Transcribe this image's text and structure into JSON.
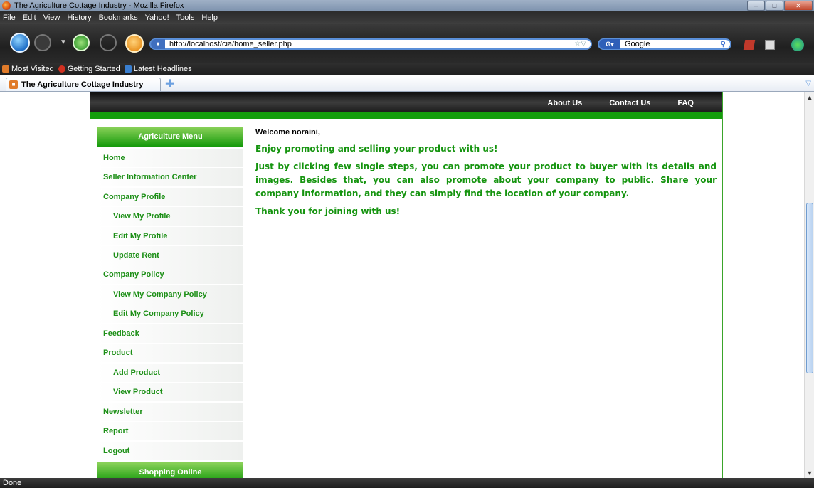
{
  "window": {
    "title": "The Agriculture Cottage Industry - Mozilla Firefox",
    "controls": [
      "minimize",
      "maximize",
      "close"
    ]
  },
  "menubar": [
    "File",
    "Edit",
    "View",
    "History",
    "Bookmarks",
    "Yahoo!",
    "Tools",
    "Help"
  ],
  "navbar": {
    "url": "http://localhost/cia/home_seller.php",
    "search_engine": "Google",
    "search_placeholder": "Google"
  },
  "bookmarks": [
    "Most Visited",
    "Getting Started",
    "Latest Headlines"
  ],
  "tabs": [
    {
      "label": "The Agriculture Cottage Industry"
    }
  ],
  "site": {
    "topnav": [
      "About Us",
      "Contact Us",
      "FAQ"
    ],
    "menu_heading": "Agriculture Menu",
    "menu_items": [
      {
        "label": "Home",
        "sub": false
      },
      {
        "label": "Seller Information Center",
        "sub": false
      },
      {
        "label": "Company Profile",
        "sub": false
      },
      {
        "label": "View My Profile",
        "sub": true
      },
      {
        "label": "Edit My Profile",
        "sub": true
      },
      {
        "label": "Update Rent",
        "sub": true
      },
      {
        "label": "Company Policy",
        "sub": false
      },
      {
        "label": "View My Company Policy",
        "sub": true
      },
      {
        "label": "Edit My Company Policy",
        "sub": true
      },
      {
        "label": "Feedback",
        "sub": false
      },
      {
        "label": "Product",
        "sub": false
      },
      {
        "label": "Add Product",
        "sub": true
      },
      {
        "label": "View Product",
        "sub": true
      },
      {
        "label": "Newsletter",
        "sub": false
      },
      {
        "label": "Report",
        "sub": false
      },
      {
        "label": "Logout",
        "sub": false
      }
    ],
    "shopping_heading": "Shopping Online",
    "welcome": "Welcome noraini,",
    "paragraphs": [
      "Enjoy promoting and selling your product with us!",
      "Just by clicking few single steps, you can promote your product to buyer with its details and images. Besides that, you can also promote about your company to public. Share your company information, and they can simply find the location of your company.",
      "Thank you for joining with us!"
    ]
  },
  "status": "Done",
  "colors": {
    "accent_green": "#139d0b",
    "menu_text_green": "#1c8f16",
    "nav_dark": "#1a1a1a"
  }
}
